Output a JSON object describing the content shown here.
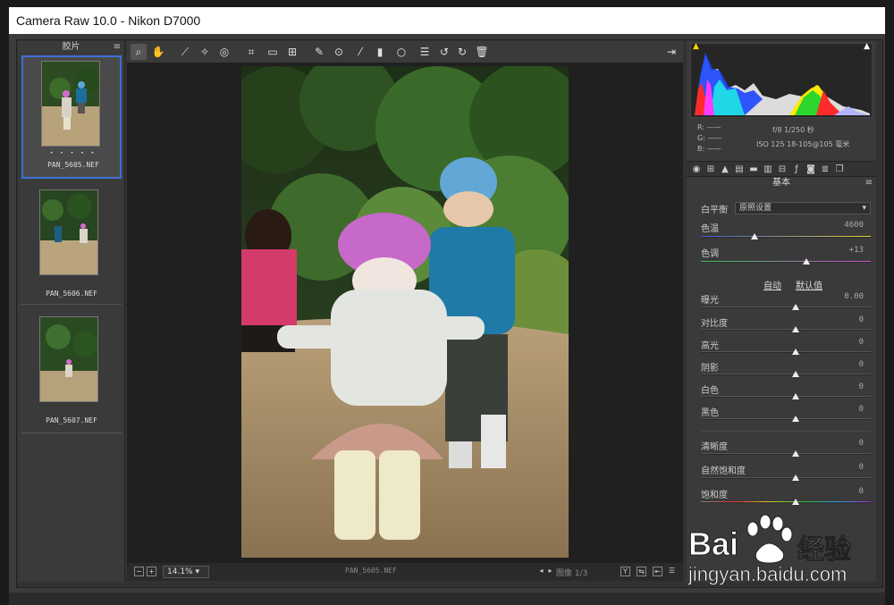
{
  "window": {
    "title": "Camera Raw 10.0 -  Nikon D7000"
  },
  "filmstrip": {
    "header": "胶片",
    "items": [
      {
        "name": "PAN_5605.NEF",
        "selected": true,
        "stars": "• • • • •"
      },
      {
        "name": "PAN_5606.NEF",
        "selected": false
      },
      {
        "name": "PAN_5607.NEF",
        "selected": false
      }
    ]
  },
  "toolbar": {
    "icons": [
      "zoom-icon",
      "hand-icon",
      "white-balance-icon",
      "color-sampler-icon",
      "targeted-adjust-icon",
      "crop-icon",
      "straighten-icon",
      "transform-icon",
      "spot-removal-icon",
      "red-eye-icon",
      "adjustment-brush-icon",
      "graduated-filter-icon",
      "radial-filter-icon",
      "presets-list-icon",
      "rotate-ccw-icon",
      "rotate-cw-icon",
      "trash-icon"
    ]
  },
  "status": {
    "zoom": "14.1%",
    "filename": "PAN_5605.NEF",
    "image_label": "图像 1/3",
    "view_y": "Y"
  },
  "histogram_meta": {
    "r": "R:  ——",
    "g": "G:  ——",
    "b": "B:  ——",
    "exposure": "f/8   1/250 秒",
    "iso": "ISO 125   18-105@105 毫米"
  },
  "panel": {
    "title": "基本",
    "white_balance_label": "白平衡",
    "white_balance_value": "原照设置",
    "auto_link": "自动",
    "default_link": "默认值",
    "sliders": [
      {
        "label": "色温",
        "value": "4600"
      },
      {
        "label": "色调",
        "value": "+13"
      },
      {
        "label": "曝光",
        "value": "0.00"
      },
      {
        "label": "对比度",
        "value": "0"
      },
      {
        "label": "高光",
        "value": "0"
      },
      {
        "label": "阴影",
        "value": "0"
      },
      {
        "label": "白色",
        "value": "0"
      },
      {
        "label": "黑色",
        "value": "0"
      },
      {
        "label": "清晰度",
        "value": "0"
      },
      {
        "label": "自然饱和度",
        "value": "0"
      },
      {
        "label": "饱和度",
        "value": "0"
      }
    ]
  },
  "watermark": {
    "brand": "Bai",
    "brand2": "经验",
    "url": "jingyan.baidu.com"
  }
}
